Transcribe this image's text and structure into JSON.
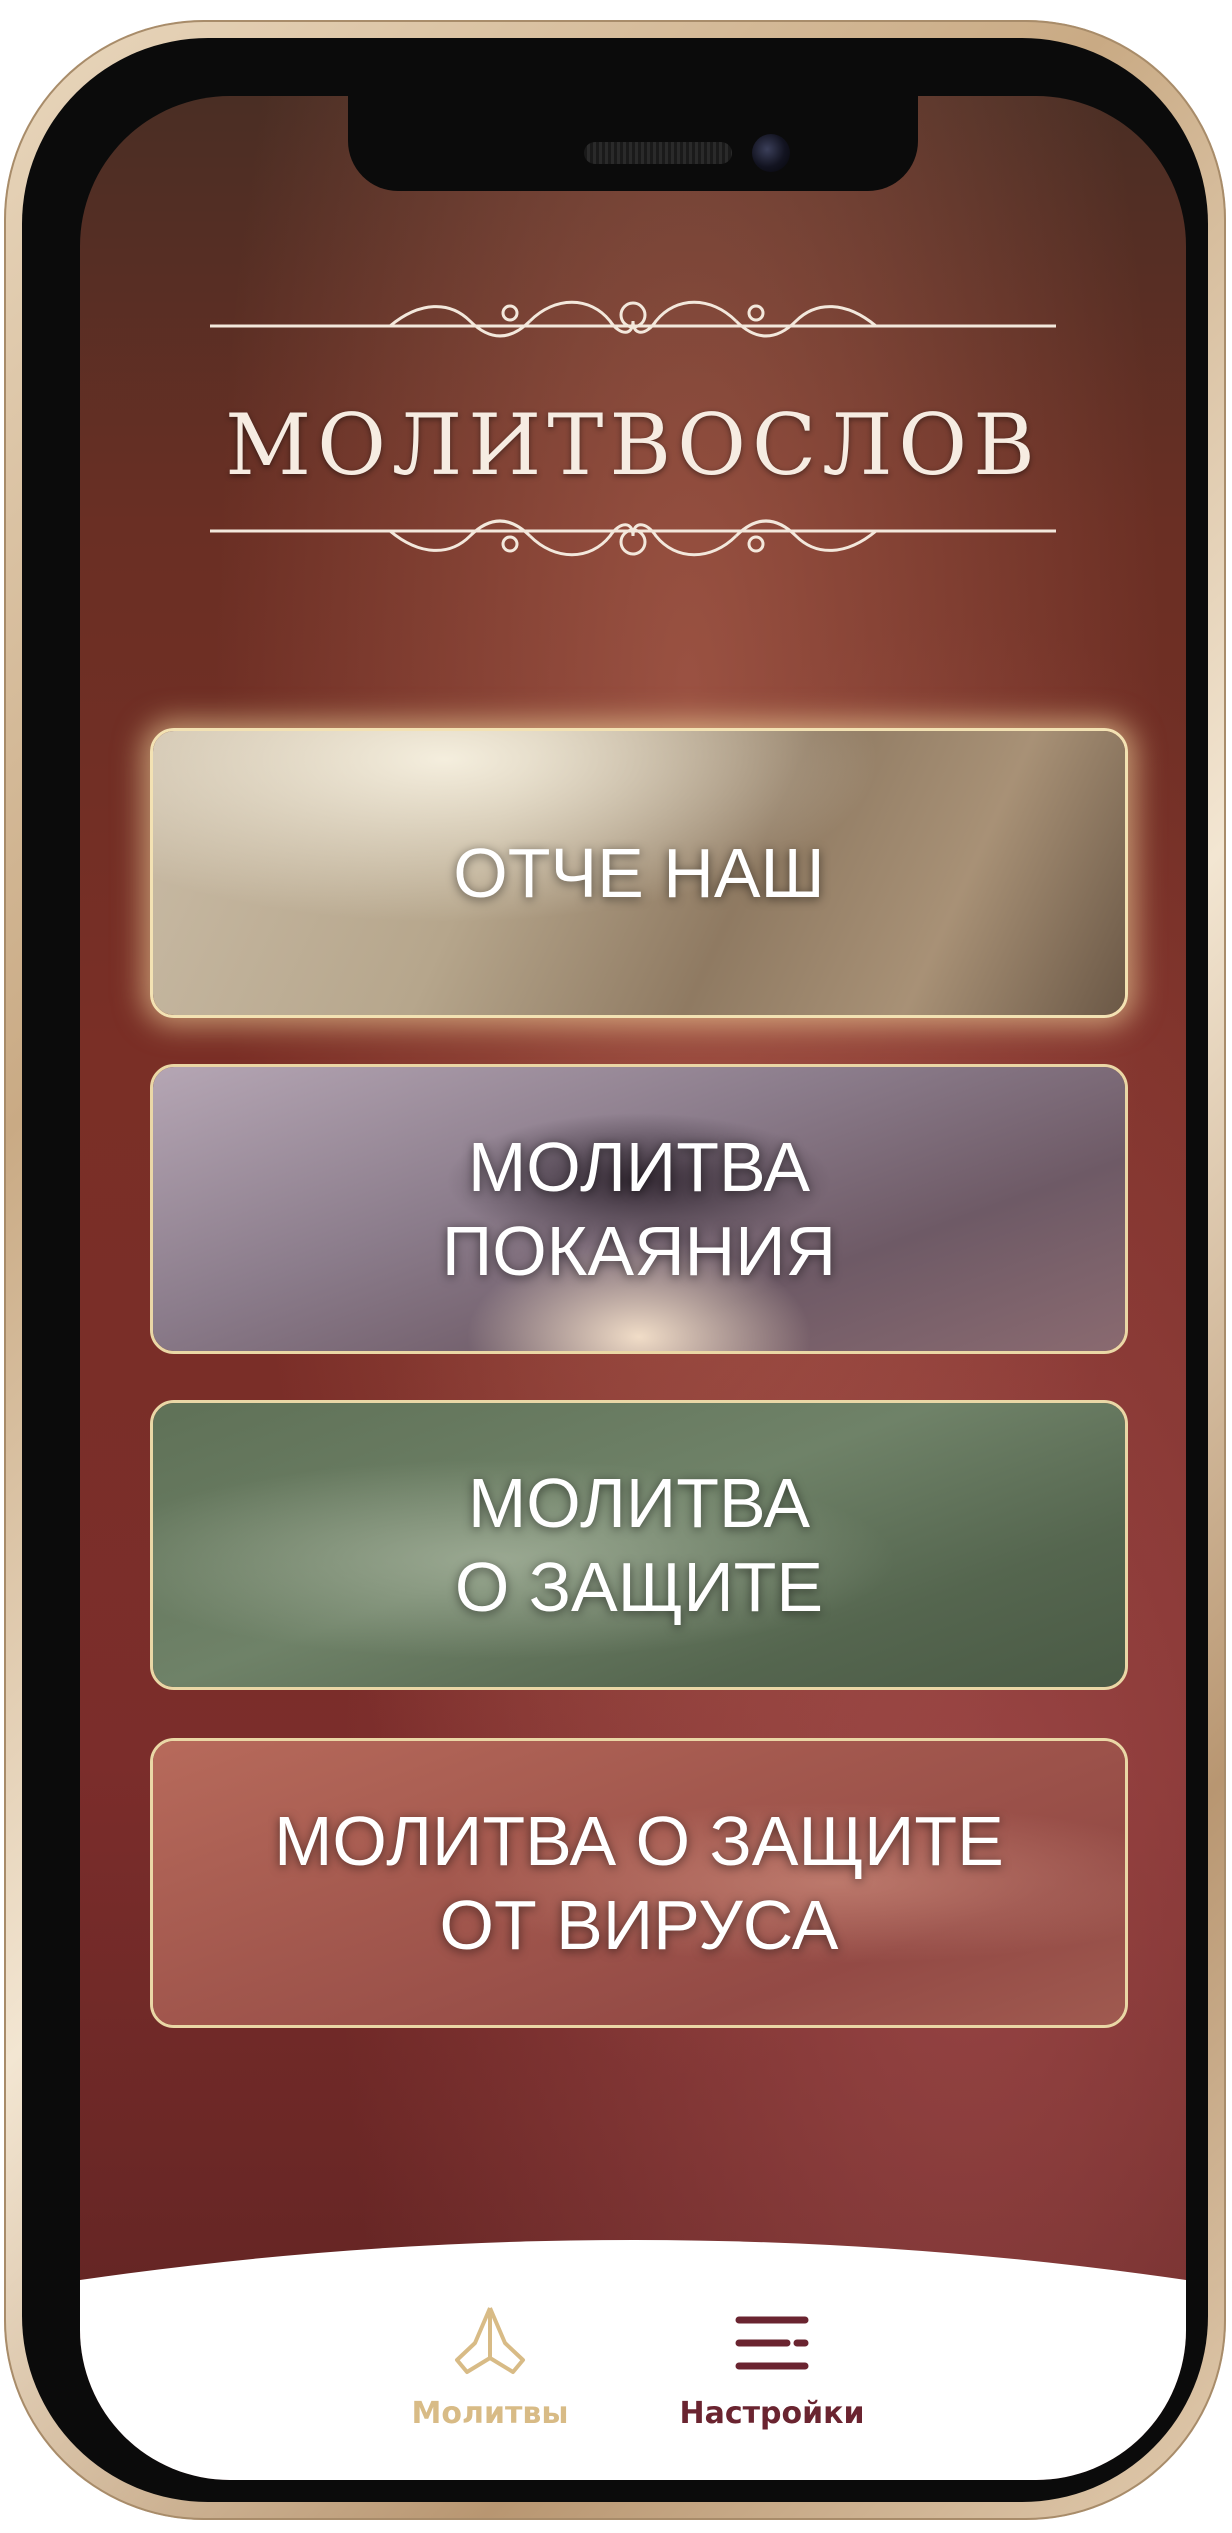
{
  "app": {
    "title": "МОЛИТВОСЛОВ"
  },
  "prayers": [
    {
      "label": "ОТЧЕ НАШ"
    },
    {
      "label": "МОЛИТВА\nПОКАЯНИЯ"
    },
    {
      "label": "МОЛИТВА\nО ЗАЩИТЕ"
    },
    {
      "label": "МОЛИТВА О ЗАЩИТЕ\nОТ ВИРУСА"
    }
  ],
  "tabbar": {
    "prayers": {
      "label": "Молитвы",
      "icon": "praying-hands-icon",
      "active": true
    },
    "settings": {
      "label": "Настройки",
      "icon": "menu-lines-icon",
      "active": false
    }
  },
  "colors": {
    "background": "#7a2f26",
    "card_border": "#ead7a6",
    "tab_active": "#d8bb86",
    "tab_inactive": "#6a2430"
  }
}
